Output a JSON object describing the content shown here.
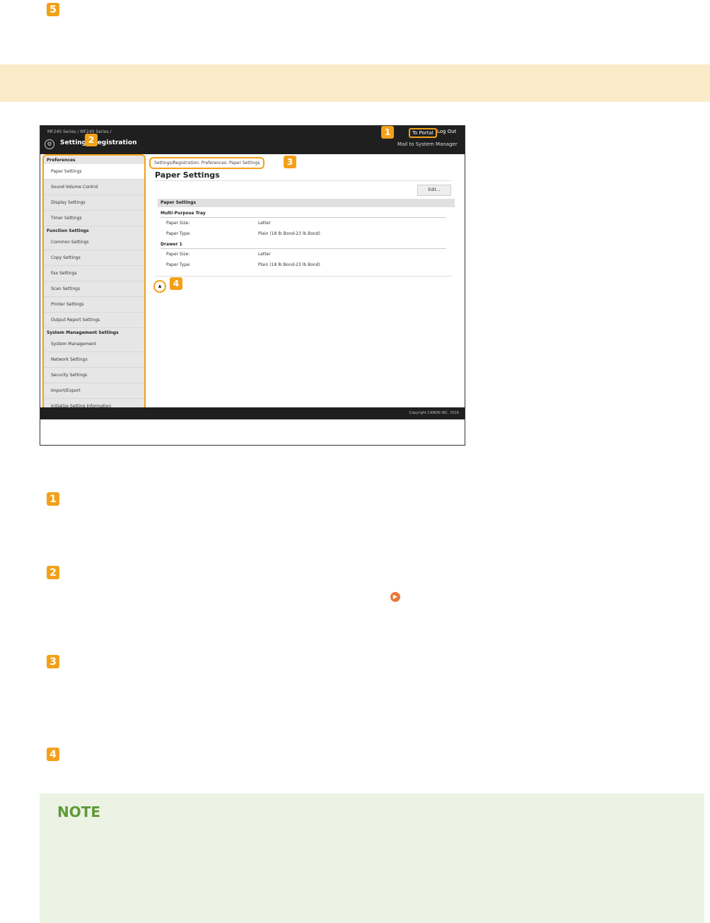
{
  "step5_badge": "5",
  "screenshot": {
    "model_text": "MF240 Series / MF240 Series /",
    "to_portal": "To Portal",
    "log_out": "Log Out",
    "mail_to": "Mail to System Manager",
    "gear_glyph": "⚙",
    "app_title": "Settings/Registration",
    "breadcrumb": "Settings/Registration: Preferences: Paper Settings",
    "page_title": "Paper Settings",
    "edit_label": "Edit...",
    "section_title": "Paper Settings",
    "groups": [
      {
        "name": "Multi-Purpose Tray",
        "size_label": "Paper Size:",
        "size_value": "Letter",
        "type_label": "Paper Type:",
        "type_value": "Plain (18 lb Bond-23 lb Bond)"
      },
      {
        "name": "Drawer 1",
        "size_label": "Paper Size:",
        "size_value": "Letter",
        "type_label": "Paper Type:",
        "type_value": "Plain (18 lb Bond-23 lb Bond)"
      }
    ],
    "to_top_glyph": "▲",
    "copyright": "Copyright CANON INC. 2016",
    "sidebar": {
      "preferences": "Preferences",
      "pref_items": [
        "Paper Settings",
        "Sound Volume Control",
        "Display Settings",
        "Timer Settings"
      ],
      "function": "Function Settings",
      "func_items": [
        "Common Settings",
        "Copy Settings",
        "Fax Settings",
        "Scan Settings",
        "Printer Settings",
        "Output Report Settings"
      ],
      "system": "System Management Settings",
      "sys_items": [
        "System Management",
        "Network Settings",
        "Security Settings",
        "Import/Export",
        "Initialize Setting Information"
      ]
    },
    "callouts": [
      "1",
      "2",
      "3",
      "4"
    ]
  },
  "list_badges": [
    "1",
    "2",
    "3",
    "4"
  ],
  "note_title": "NOTE",
  "colors": {
    "accent": "#f3a019",
    "band": "#fbebc9",
    "note_bg": "#edf3e4",
    "note_title": "#5f9a3a"
  }
}
